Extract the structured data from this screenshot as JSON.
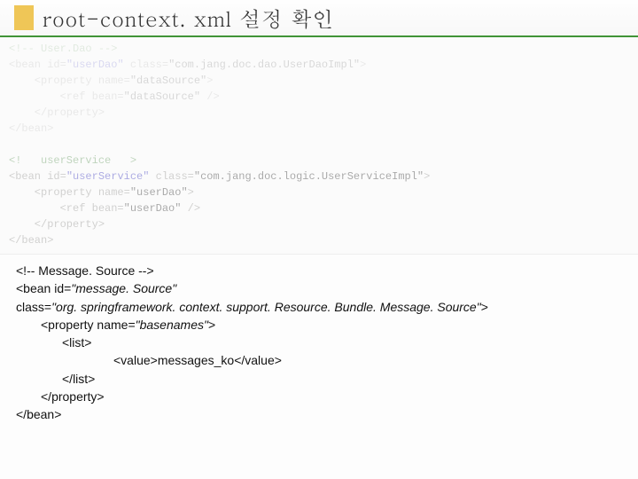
{
  "header": {
    "title": "root-context. xml 설정 확인"
  },
  "code": {
    "lines": [
      {
        "cls": "comment-faded",
        "text": "<!-- User.Dao -->"
      },
      {
        "cls": "tag-faded",
        "text": "<bean id=\"userDao\" class=\"com.jang.doc.dao.UserDaoImpl\">",
        "idAttr": "userDao"
      },
      {
        "cls": "tag-faded",
        "text": "    <property name=\"dataSource\">"
      },
      {
        "cls": "tag-faded",
        "text": "        <ref bean=\"dataSource\" />"
      },
      {
        "cls": "tag-faded",
        "text": "    </property>"
      },
      {
        "cls": "tag-faded",
        "text": "</bean>"
      },
      {
        "cls": "",
        "text": " "
      },
      {
        "cls": "comment-mid",
        "text": "<!   userService   >"
      },
      {
        "cls": "tag-mid",
        "text": "<bean id=\"userService\" class=\"com.jang.doc.logic.UserServiceImpl\">",
        "idAttr": "userService"
      },
      {
        "cls": "tag-mid",
        "text": "    <property name=\"userDao\">"
      },
      {
        "cls": "tag-mid",
        "text": "        <ref bean=\"userDao\" />"
      },
      {
        "cls": "tag-mid",
        "text": "    </property>"
      },
      {
        "cls": "tag-mid",
        "text": "</bean>"
      }
    ]
  },
  "snippet": {
    "l1": "<!-- Message. Source -->",
    "l2a": "<bean id=",
    "l2b": "\"message. Source\"",
    "l3a": "class=",
    "l3b": "\"org. springframework. context. support. Resource. Bundle. Message. Source\"",
    "l3c": ">",
    "l4a": "<property name=",
    "l4b": "\"basenames\"",
    "l4c": ">",
    "l5": "<list>",
    "l6": "<value>messages_ko</value>",
    "l7": "</list>",
    "l8": "</property>",
    "l9": "</bean>"
  }
}
